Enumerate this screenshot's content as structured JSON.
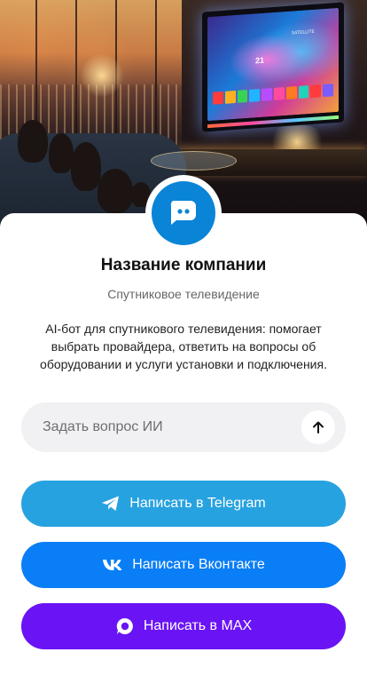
{
  "hero": {
    "tv_menu": [
      "",
      "",
      "",
      "",
      "SATELLITE",
      ""
    ],
    "tv_number": "21",
    "tile_colors": [
      "#ff3b3b",
      "#ffb020",
      "#39d353",
      "#20b5ff",
      "#b84dff",
      "#ff4aa0",
      "#ff7a20",
      "#22d3b8",
      "#ff3b3b",
      "#7a5cff"
    ]
  },
  "company": {
    "name": "Название компании",
    "category": "Спутниковое телевидение",
    "description": "AI-бот для спутникового телевидения: помогает выбрать провайдера, ответить на вопросы об оборудовании и услуги установки и подключения."
  },
  "ask": {
    "placeholder": "Задать вопрос ИИ",
    "send_icon": "arrow-up-icon"
  },
  "buttons": {
    "telegram": {
      "label": "Написать в Telegram",
      "color": "#27a2e0",
      "icon": "telegram-icon"
    },
    "vk": {
      "label": "Написать Вконтакте",
      "color": "#0a7ef6",
      "icon": "vk-icon"
    },
    "max": {
      "label": "Написать в MAX",
      "color": "#6a13f5",
      "icon": "max-icon"
    }
  },
  "logo": {
    "color": "#0a84d6",
    "icon": "chat-bubble-icon"
  }
}
